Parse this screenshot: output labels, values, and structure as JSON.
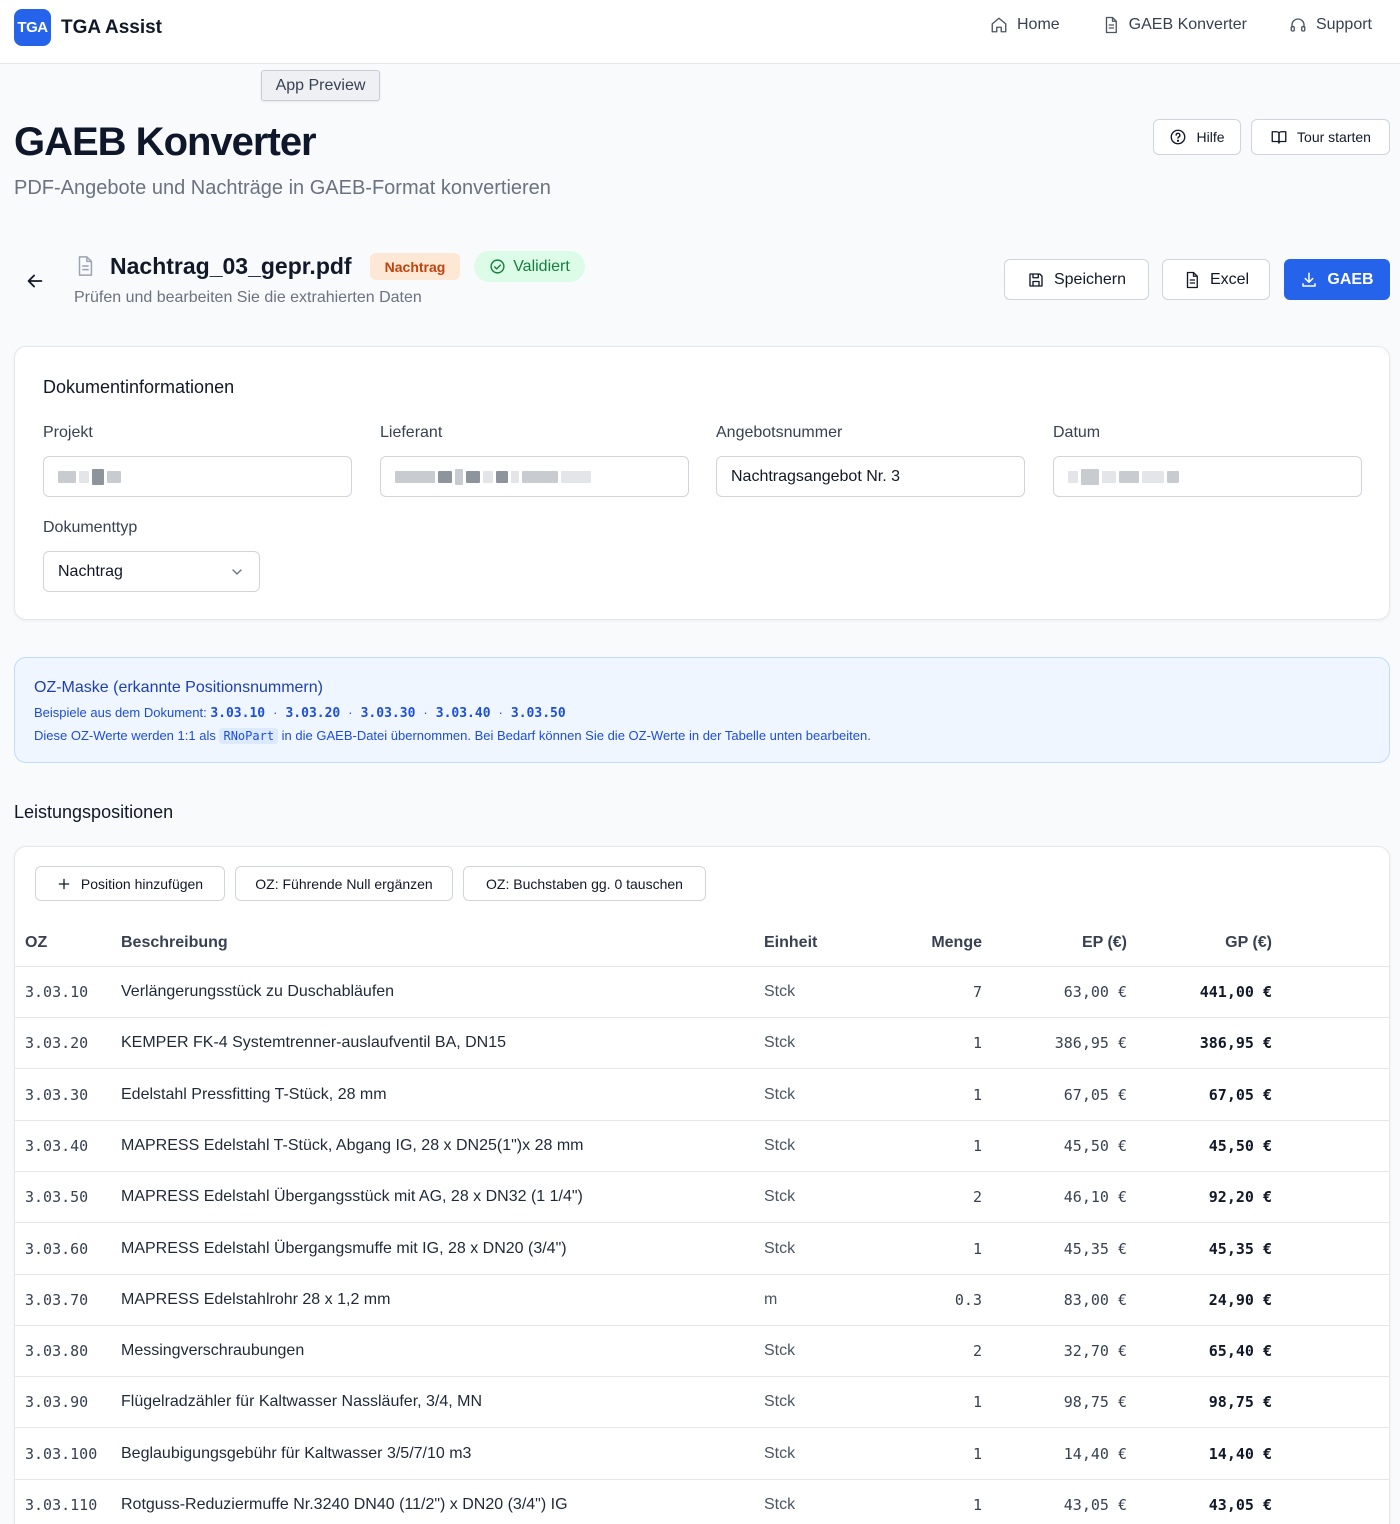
{
  "header": {
    "logo_text": "TGA",
    "app_name": "TGA Assist",
    "nav": [
      {
        "label": "Home",
        "icon": "home-icon"
      },
      {
        "label": "GAEB Konverter",
        "icon": "document-icon"
      },
      {
        "label": "Support",
        "icon": "headset-icon"
      }
    ]
  },
  "preview_tag": "App Preview",
  "page": {
    "title": "GAEB Konverter",
    "subtitle": "PDF-Angebote und Nachträge in GAEB-Format konvertieren",
    "help_label": "Hilfe",
    "tour_label": "Tour starten"
  },
  "document": {
    "file_name": "Nachtrag_03_gepr.pdf",
    "type_badge": "Nachtrag",
    "status_badge": "Validiert",
    "subtitle": "Prüfen und bearbeiten Sie die extrahierten Daten",
    "actions": {
      "save": "Speichern",
      "excel": "Excel",
      "gaeb": "GAEB"
    }
  },
  "doc_info": {
    "title": "Dokumentinformationen",
    "fields": {
      "projekt_label": "Projekt",
      "lieferant_label": "Lieferant",
      "angebotsnummer_label": "Angebotsnummer",
      "angebotsnummer_value": "Nachtragsangebot Nr. 3",
      "datum_label": "Datum",
      "dokumenttyp_label": "Dokumenttyp",
      "dokumenttyp_value": "Nachtrag"
    }
  },
  "oz_mask": {
    "title": "OZ-Maske (erkannte Positionsnummern)",
    "examples_prefix": "Beispiele aus dem Dokument:",
    "examples": [
      "3.03.10",
      "3.03.20",
      "3.03.30",
      "3.03.40",
      "3.03.50"
    ],
    "separator": "·",
    "note_before": "Diese OZ-Werte werden 1:1 als",
    "note_code": "RNoPart",
    "note_after": "in die GAEB-Datei übernommen. Bei Bedarf können Sie die OZ-Werte in der Tabelle unten bearbeiten."
  },
  "positions": {
    "title": "Leistungspositionen",
    "toolbar": {
      "add": "Position hinzufügen",
      "lead_zero": "OZ: Führende Null ergänzen",
      "swap": "OZ: Buchstaben gg. 0 tauschen"
    },
    "columns": {
      "oz": "OZ",
      "desc": "Beschreibung",
      "unit": "Einheit",
      "qty": "Menge",
      "ep": "EP (€)",
      "gp": "GP (€)"
    },
    "rows": [
      {
        "oz": "3.03.10",
        "desc": "Verlängerungsstück zu Duschabläufen",
        "unit": "Stck",
        "qty": "7",
        "ep": "63,00 €",
        "gp": "441,00 €"
      },
      {
        "oz": "3.03.20",
        "desc": "KEMPER FK-4 Systemtrenner-auslaufventil BA, DN15",
        "unit": "Stck",
        "qty": "1",
        "ep": "386,95 €",
        "gp": "386,95 €"
      },
      {
        "oz": "3.03.30",
        "desc": "Edelstahl Pressfitting T-Stück, 28 mm",
        "unit": "Stck",
        "qty": "1",
        "ep": "67,05 €",
        "gp": "67,05 €"
      },
      {
        "oz": "3.03.40",
        "desc": "MAPRESS Edelstahl T-Stück, Abgang IG, 28 x DN25(1\")x 28 mm",
        "unit": "Stck",
        "qty": "1",
        "ep": "45,50 €",
        "gp": "45,50 €"
      },
      {
        "oz": "3.03.50",
        "desc": "MAPRESS Edelstahl Übergangsstück mit AG, 28 x DN32 (1 1/4\")",
        "unit": "Stck",
        "qty": "2",
        "ep": "46,10 €",
        "gp": "92,20 €"
      },
      {
        "oz": "3.03.60",
        "desc": "MAPRESS Edelstahl Übergangsmuffe mit IG, 28 x DN20 (3/4\")",
        "unit": "Stck",
        "qty": "1",
        "ep": "45,35 €",
        "gp": "45,35 €"
      },
      {
        "oz": "3.03.70",
        "desc": "MAPRESS Edelstahlrohr 28 x 1,2 mm",
        "unit": "m",
        "qty": "0.3",
        "ep": "83,00 €",
        "gp": "24,90 €"
      },
      {
        "oz": "3.03.80",
        "desc": "Messingverschraubungen",
        "unit": "Stck",
        "qty": "2",
        "ep": "32,70 €",
        "gp": "65,40 €"
      },
      {
        "oz": "3.03.90",
        "desc": "Flügelradzähler für Kaltwasser Nassläufer, 3/4, MN",
        "unit": "Stck",
        "qty": "1",
        "ep": "98,75 €",
        "gp": "98,75 €"
      },
      {
        "oz": "3.03.100",
        "desc": "Beglaubigungsgebühr für Kaltwasser 3/5/7/10 m3",
        "unit": "Stck",
        "qty": "1",
        "ep": "14,40 €",
        "gp": "14,40 €"
      },
      {
        "oz": "3.03.110",
        "desc": "Rotguss-Reduziermuffe Nr.3240 DN40 (11/2\") x DN20 (3/4\") IG",
        "unit": "Stck",
        "qty": "1",
        "ep": "43,05 €",
        "gp": "43,05 €"
      }
    ]
  },
  "colors": {
    "primary": "#2563eb",
    "success": "#15803d",
    "warning": "#c2410c",
    "info": "#1d4ed8"
  }
}
